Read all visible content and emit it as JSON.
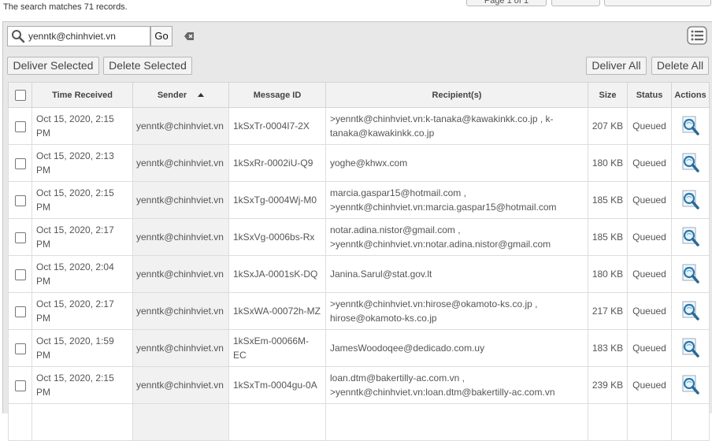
{
  "header": {
    "match_text": "The search matches 71 records.",
    "page_label": "Page 1 of 1"
  },
  "search": {
    "value": "yenntk@chinhviet.vn",
    "go_label": "Go"
  },
  "toolbar": {
    "deliver_selected": "Deliver Selected",
    "delete_selected": "Delete Selected",
    "deliver_all": "Deliver All",
    "delete_all": "Delete All"
  },
  "table": {
    "columns": {
      "time": "Time Received",
      "sender": "Sender",
      "message_id": "Message ID",
      "recipients": "Recipient(s)",
      "size": "Size",
      "status": "Status",
      "actions": "Actions"
    },
    "sort": {
      "column": "sender",
      "direction": "ascending"
    },
    "rows": [
      {
        "time": "Oct 15, 2020, 2:15 PM",
        "sender": "yenntk@chinhviet.vn",
        "message_id": "1kSxTr-0004I7-2X",
        "recipients": ">yenntk@chinhviet.vn:k-tanaka@kawakinkk.co.jp , k-tanaka@kawakinkk.co.jp",
        "size": "207 KB",
        "status": "Queued"
      },
      {
        "time": "Oct 15, 2020, 2:13 PM",
        "sender": "yenntk@chinhviet.vn",
        "message_id": "1kSxRr-0002iU-Q9",
        "recipients": "yoghe@khwx.com",
        "size": "180 KB",
        "status": "Queued"
      },
      {
        "time": "Oct 15, 2020, 2:15 PM",
        "sender": "yenntk@chinhviet.vn",
        "message_id": "1kSxTg-0004Wj-M0",
        "recipients": "marcia.gaspar15@hotmail.com , >yenntk@chinhviet.vn:marcia.gaspar15@hotmail.com",
        "size": "185 KB",
        "status": "Queued"
      },
      {
        "time": "Oct 15, 2020, 2:17 PM",
        "sender": "yenntk@chinhviet.vn",
        "message_id": "1kSxVg-0006bs-Rx",
        "recipients": "notar.adina.nistor@gmail.com , >yenntk@chinhviet.vn:notar.adina.nistor@gmail.com",
        "size": "185 KB",
        "status": "Queued"
      },
      {
        "time": "Oct 15, 2020, 2:04 PM",
        "sender": "yenntk@chinhviet.vn",
        "message_id": "1kSxJA-0001sK-DQ",
        "recipients": "Janina.Sarul@stat.gov.lt",
        "size": "180 KB",
        "status": "Queued"
      },
      {
        "time": "Oct 15, 2020, 2:17 PM",
        "sender": "yenntk@chinhviet.vn",
        "message_id": "1kSxWA-00072h-MZ",
        "recipients": ">yenntk@chinhviet.vn:hirose@okamoto-ks.co.jp , hirose@okamoto-ks.co.jp",
        "size": "217 KB",
        "status": "Queued"
      },
      {
        "time": "Oct 15, 2020, 1:59 PM",
        "sender": "yenntk@chinhviet.vn",
        "message_id": "1kSxEm-00066M-EC",
        "recipients": "JamesWoodoqee@dedicado.com.uy",
        "size": "183 KB",
        "status": "Queued"
      },
      {
        "time": "Oct 15, 2020, 2:15 PM",
        "sender": "yenntk@chinhviet.vn",
        "message_id": "1kSxTm-0004gu-0A",
        "recipients": "loan.dtm@bakertilly-ac.com.vn , >yenntk@chinhviet.vn:loan.dtm@bakertilly-ac.com.vn",
        "size": "239 KB",
        "status": "Queued"
      }
    ]
  },
  "icons": {
    "search": "search-icon",
    "clear": "clear-search-icon",
    "list": "list-view-icon",
    "view": "magnifier-view-icon"
  },
  "colors": {
    "panel": "#e8e8e8",
    "sender_column": "#f1f1f1",
    "header": "#f2f2f2",
    "view_icon": "#2a7ab0"
  }
}
